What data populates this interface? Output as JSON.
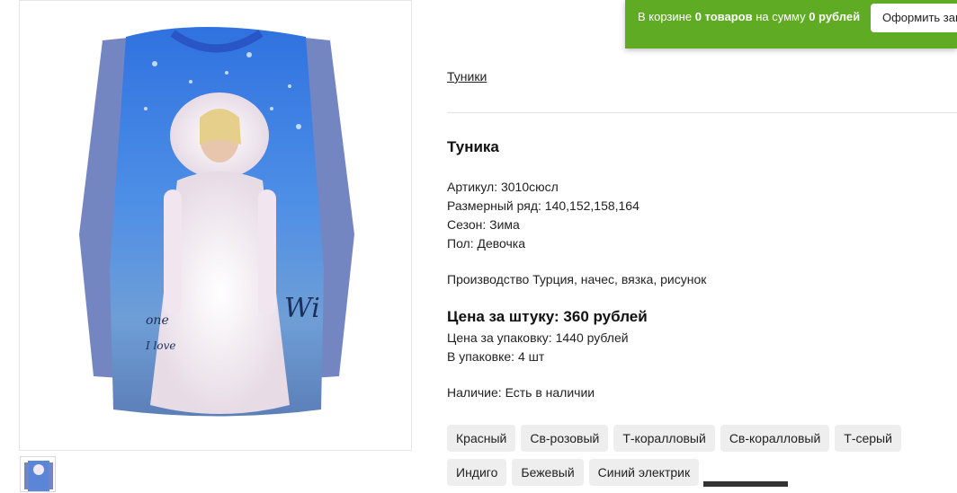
{
  "cart": {
    "prefix": "В корзине ",
    "count": "0 товаров",
    "middle": " на сумму ",
    "sum": "0 рублей",
    "checkout_label": "Оформить заказ"
  },
  "breadcrumb": "Туники",
  "product": {
    "title": "Туника",
    "specs": [
      "Артикул: 3010сюсл",
      "Размерный ряд: 140,152,158,164",
      "Сезон: Зима",
      "Пол: Девочка"
    ],
    "description": "Производство Турция, начес, вязка, рисунок",
    "price_main": "Цена за штуку: 360 рублей",
    "price_pack": "Цена за упаковку: 1440 рублей",
    "pack_count": "В упаковке: 4 шт",
    "availability": "Наличие: Есть в наличии"
  },
  "colors": [
    "Красный",
    "Св-розовый",
    "Т-коралловый",
    "Св-коралловый",
    "Т-серый",
    "Индиго",
    "Бежевый",
    "Синий электрик"
  ],
  "swatches": [
    "#3f63c9",
    "#8f8590",
    "#d94466",
    "#d864c2",
    "#e2447a",
    "#e2444f"
  ],
  "image_text": [
    "one",
    "Wi",
    "I love"
  ]
}
